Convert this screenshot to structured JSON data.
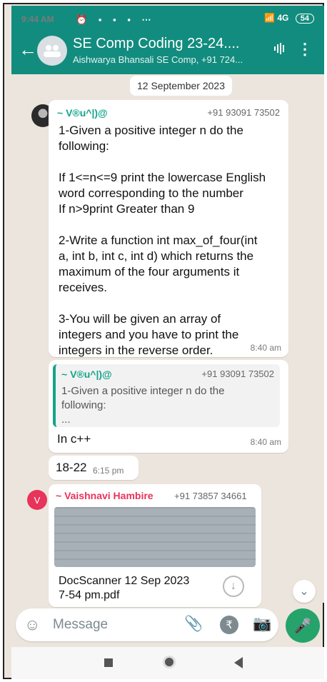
{
  "status_bar": {
    "time": "9:44 AM",
    "icons_left": "⏰ ▪ ▪ ▪ ⋯",
    "icons_right": "📶 4G",
    "battery": "54"
  },
  "header": {
    "title": "SE Comp Coding 23-24....",
    "subtitle": "Aishwarya Bhansali SE Comp, +91 724..."
  },
  "chat": {
    "date": "12 September 2023",
    "messages": [
      {
        "sender": "~ V®u^|)@",
        "phone": "+91 93091 73502",
        "text": "1-Given a positive integer n do the\nfollowing:\n\nIf 1<=n<=9 print the lowercase English\nword corresponding to the number\nIf n>9print Greater than 9\n\n2-Write a function int max_of_four(int\na, int b, int c, int d) which returns the\nmaximum of the four arguments it\nreceives.\n\n3-You will be given an array of\nintegers and you have to print the\nintegers in the reverse order.",
        "time": "8:40 am"
      },
      {
        "quote_sender": "~ V®u^|)@",
        "quote_phone": "+91 93091 73502",
        "quote_text": "1-Given a positive integer n do the\nfollowing:\n...",
        "text": "In c++",
        "time": "8:40 am"
      },
      {
        "text": "18-22",
        "time": "6:15 pm"
      },
      {
        "avatar_letter": "V",
        "sender": "~ Vaishnavi Hambire",
        "phone": "+91 73857 34661",
        "doc_title": "DocScanner 12 Sep 2023\n7-54 pm.pdf"
      }
    ]
  },
  "input": {
    "placeholder": "Message"
  },
  "colors": {
    "header": "#128c7e",
    "accent": "#14a38b",
    "chat_bg": "#ece5dd",
    "mic": "#25a36a"
  },
  "icons": [
    "back-arrow-icon",
    "group-avatar-icon",
    "voice-call-icon",
    "more-vert-icon",
    "emoji-icon",
    "attach-icon",
    "rupee-icon",
    "camera-icon",
    "mic-icon",
    "download-icon",
    "chevron-down-icon"
  ]
}
